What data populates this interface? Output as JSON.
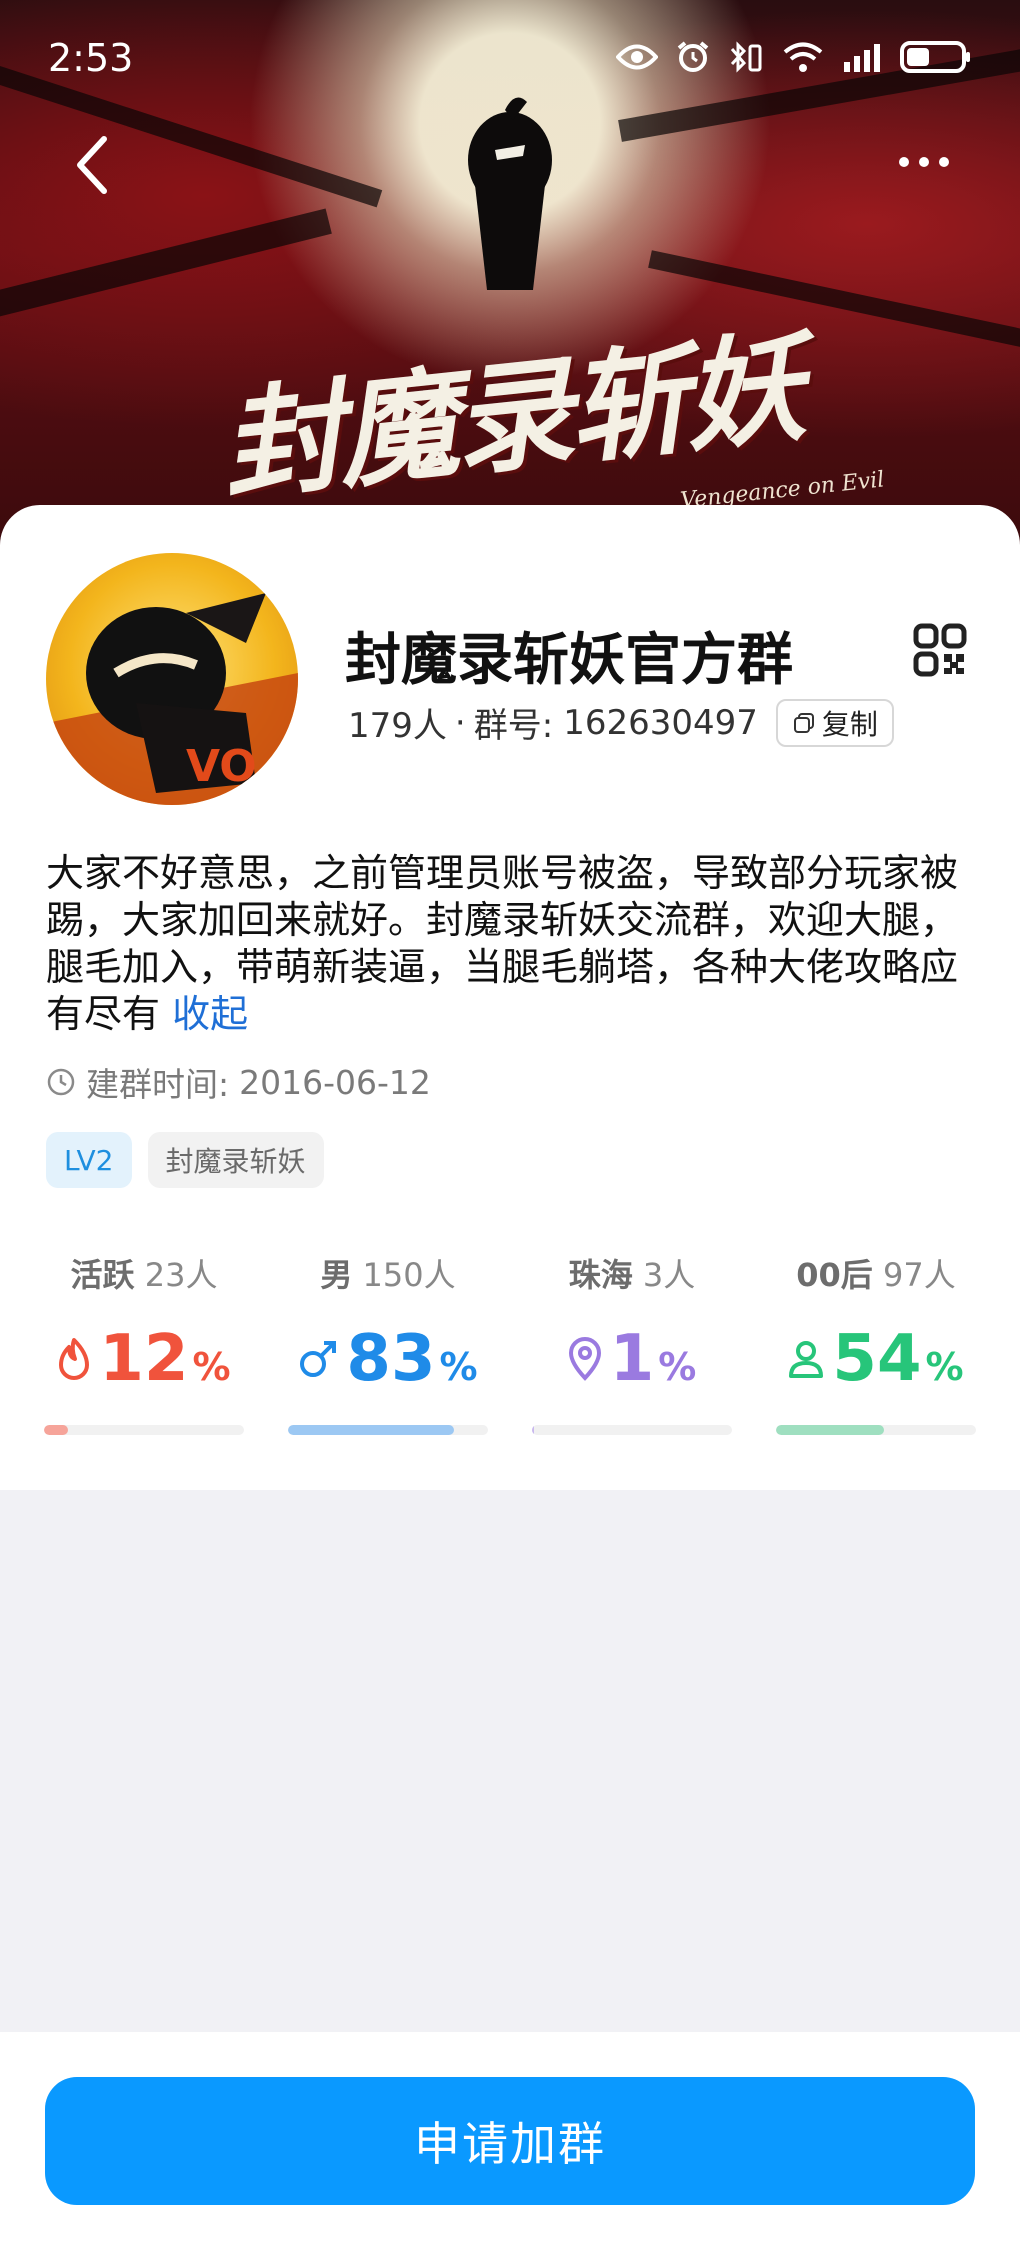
{
  "status_bar": {
    "time": "2:53"
  },
  "banner": {
    "title": "封魔录斩妖",
    "subtitle": "Vengeance on Evil"
  },
  "group": {
    "name": "封魔录斩妖官方群",
    "member_count": "179人",
    "id_label": "群号:",
    "id_value": "162630497",
    "copy_label": "复制",
    "description": "大家不好意思，之前管理员账号被盗，导致部分玩家被踢，大家加回来就好。封魔录斩妖交流群，欢迎大腿，腿毛加入，带萌新装逼，当腿毛躺塔，各种大佬攻略应有尽有",
    "collapse_label": "收起",
    "created_label": "建群时间:",
    "created_date": "2016-06-12",
    "tags": [
      "LV2",
      "封魔录斩妖"
    ]
  },
  "stats": [
    {
      "key": "活跃",
      "count": "23人",
      "percent": "12",
      "unit": "%",
      "fraction": 0.12,
      "color": "#f0533c",
      "bar_color": "#f6a49a",
      "icon": "fire-icon"
    },
    {
      "key": "男",
      "count": "150人",
      "percent": "83",
      "unit": "%",
      "fraction": 0.83,
      "color": "#1f8be8",
      "bar_color": "#9cc8f3",
      "icon": "male-icon"
    },
    {
      "key": "珠海",
      "count": "3人",
      "percent": "1",
      "unit": "%",
      "fraction": 0.01,
      "color": "#9a7ae0",
      "bar_color": "#c9b9ee",
      "icon": "location-pin-icon"
    },
    {
      "key": "00后",
      "count": "97人",
      "percent": "54",
      "unit": "%",
      "fraction": 0.54,
      "color": "#27c57a",
      "bar_color": "#9fdfc0",
      "icon": "person-icon"
    }
  ],
  "actions": {
    "join_label": "申请加群"
  },
  "colors": {
    "primary": "#0a99ff",
    "link": "#1f6fd6"
  }
}
